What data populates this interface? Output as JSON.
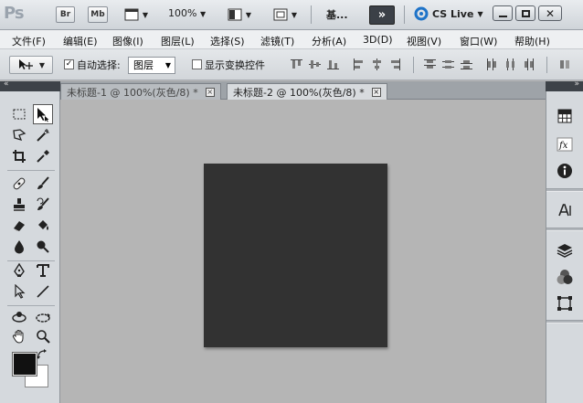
{
  "appbar": {
    "logo": "Ps",
    "bridge_label": "Br",
    "minibridge_label": "Mb",
    "zoom": "100%",
    "workspace": "基...",
    "cslive": "CS Live"
  },
  "menu": [
    "文件(F)",
    "编辑(E)",
    "图像(I)",
    "图层(L)",
    "选择(S)",
    "滤镜(T)",
    "分析(A)",
    "3D(D)",
    "视图(V)",
    "窗口(W)",
    "帮助(H)"
  ],
  "options": {
    "auto_select_label": "自动选择:",
    "auto_select_checked": "✓",
    "auto_select_target": "图层",
    "show_transform_label": "显示变换控件"
  },
  "tabs": [
    {
      "label": "未标题-1 @ 100%(灰色/8) *",
      "close": "×"
    },
    {
      "label": "未标题-2 @ 100%(灰色/8) *",
      "close": "×"
    }
  ],
  "colors": {
    "foreground": "#111111",
    "background": "#ffffff",
    "document_fill": "#323232"
  }
}
